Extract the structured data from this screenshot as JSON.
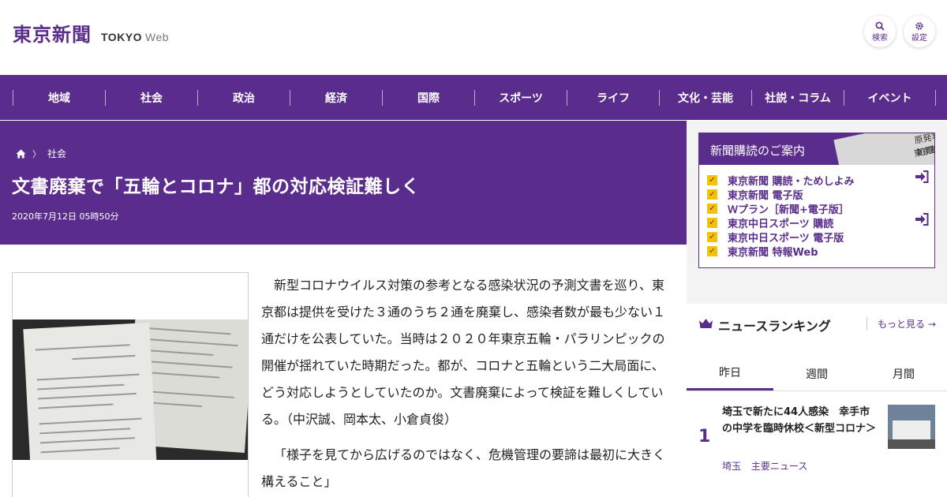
{
  "header": {
    "logo_jp": "東京新聞",
    "logo_en": "TOKYO",
    "logo_web": "Web",
    "search_label": "検索",
    "settings_label": "設定"
  },
  "nav": {
    "items": [
      "地域",
      "社会",
      "政治",
      "経済",
      "国際",
      "スポーツ",
      "ライフ",
      "文化・芸能",
      "社説・コラム",
      "イベント"
    ]
  },
  "breadcrumb": {
    "home_icon": "home-icon",
    "section": "社会"
  },
  "article": {
    "title": "文書廃棄で「五輪とコロナ」都の対応検証難しく",
    "date": "2020年7月12日 05時50分",
    "paragraphs": [
      "新型コロナウイルス対策の参考となる感染状況の予測文書を巡り、東京都は提供を受けた３通のうち２通を廃棄し、感染者数が最も少ない１通だけを公表していた。当時は２０２０年東京五輪・パラリンピックの開催が揺れていた時期だった。都が、コロナと五輪という二大局面に、どう対応しようとしていたのか。文書廃棄によって検証を難しくしている。（中沢誠、岡本太、小倉貞俊）",
      "「様子を見てから広げるのではなく、危機管理の要諦は最初に大きく構えること」"
    ]
  },
  "subscription": {
    "title": "新聞購読のご案内",
    "items": [
      "東京新聞 購読・ためしよみ",
      "東京新聞 電子版",
      "Ｗプラン［新聞+電子版］",
      "東京中日スポーツ 購読",
      "東京中日スポーツ 電子版",
      "東京新聞 特報Web"
    ]
  },
  "ranking": {
    "title": "ニュースランキング",
    "more": "もっと見る",
    "tabs": [
      "昨日",
      "週間",
      "月間"
    ],
    "active_tab": "昨日",
    "items": [
      {
        "rank": "1",
        "title": "埼玉で新たに44人感染　幸手市の中学を臨時休校＜新型コロナ＞",
        "tags": [
          "埼玉",
          "主要ニュース"
        ]
      }
    ]
  },
  "colors": {
    "brand": "#5a2d8c",
    "check": "#f4c200"
  }
}
